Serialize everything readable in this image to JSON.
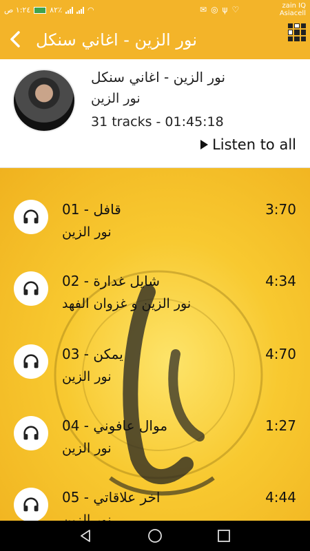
{
  "status": {
    "time": "١:٢٤ ص",
    "battery": "٨٢٪",
    "carrier": "zain IQ",
    "carrier2": "Asiacell"
  },
  "appbar": {
    "title": "نور الزين - اغاني سنكل",
    "back_icon": "chevron-left-icon",
    "menu_icon": "grid-icon"
  },
  "album": {
    "title": "نور الزين - اغاني سنكل",
    "artist": "نور الزين",
    "meta": "31 tracks - 01:45:18",
    "listen_all": "Listen to all"
  },
  "tracks": [
    {
      "number": "01",
      "name": "قافل",
      "artist": "نور الزين",
      "duration": "3:70"
    },
    {
      "number": "02",
      "name": "شايل غدارة",
      "artist": "نور الزين و غزوان الفهد",
      "duration": "4:34"
    },
    {
      "number": "03",
      "name": "يمكن",
      "artist": "نور الزين",
      "duration": "4:70"
    },
    {
      "number": "04",
      "name": "موال عافوني",
      "artist": "نور الزين",
      "duration": "1:27"
    },
    {
      "number": "05",
      "name": "اخر علاقاتي",
      "artist": "نور الزين",
      "duration": "4:44"
    }
  ],
  "colors": {
    "accent": "#f3b429",
    "list_bg": "#f8c930"
  }
}
